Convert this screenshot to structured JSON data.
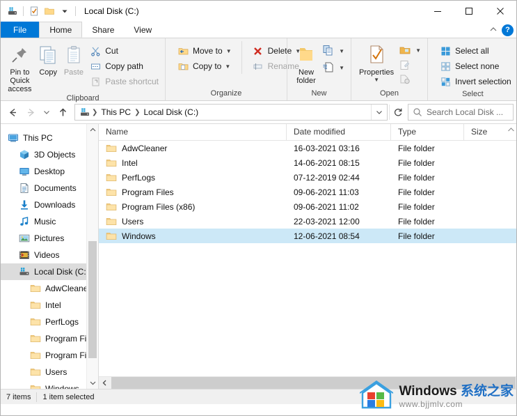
{
  "window": {
    "title": "Local Disk (C:)",
    "quick_access": [
      {
        "name": "properties-qat-icon",
        "glyph": "drive"
      },
      {
        "name": "new-folder-qat-icon",
        "glyph": "checkdoc"
      },
      {
        "name": "folder-qat-icon",
        "glyph": "folder"
      },
      {
        "name": "customize-qat-icon",
        "glyph": "caret"
      }
    ],
    "controls": {
      "minimize": "—",
      "maximize": "☐",
      "close": "✕"
    }
  },
  "tabs": [
    {
      "label": "File",
      "state": "file"
    },
    {
      "label": "Home",
      "state": "active"
    },
    {
      "label": "Share",
      "state": "normal"
    },
    {
      "label": "View",
      "state": "normal"
    }
  ],
  "ribbon": {
    "collapse_icon": "chevron-up-icon",
    "help_label": "?",
    "groups": [
      {
        "label": "Clipboard",
        "big_buttons": [
          {
            "label": "Pin to Quick access",
            "icon": "pin-icon",
            "disabled": false
          },
          {
            "label": "Copy",
            "icon": "copy-icon",
            "disabled": false
          },
          {
            "label": "Paste",
            "icon": "paste-icon",
            "disabled": true
          }
        ],
        "small_buttons": [
          {
            "label": "Cut",
            "icon": "scissors-icon",
            "disabled": false,
            "caret": false
          },
          {
            "label": "Copy path",
            "icon": "copy-path-icon",
            "disabled": false,
            "caret": false
          },
          {
            "label": "Paste shortcut",
            "icon": "paste-shortcut-icon",
            "disabled": true,
            "caret": false
          }
        ]
      },
      {
        "label": "Organize",
        "small_buttons": [
          {
            "label": "Move to",
            "icon": "move-to-icon",
            "disabled": false,
            "caret": true
          },
          {
            "label": "Copy to",
            "icon": "copy-to-icon",
            "disabled": false,
            "caret": true
          }
        ],
        "small_buttons2": [
          {
            "label": "Delete",
            "icon": "delete-icon",
            "disabled": false,
            "caret": true
          },
          {
            "label": "Rename",
            "icon": "rename-icon",
            "disabled": true,
            "caret": false
          }
        ]
      },
      {
        "label": "New",
        "big_buttons": [
          {
            "label": "New folder",
            "icon": "new-folder-icon",
            "disabled": false
          }
        ],
        "small_buttons": [
          {
            "label": "",
            "icon": "new-item-icon",
            "disabled": false,
            "caret": true
          },
          {
            "label": "",
            "icon": "easy-access-icon",
            "disabled": false,
            "caret": true
          }
        ]
      },
      {
        "label": "Open",
        "big_buttons": [
          {
            "label": "Properties",
            "icon": "properties-icon",
            "disabled": false,
            "caret": true
          }
        ],
        "small_buttons": [
          {
            "label": "",
            "icon": "open-icon",
            "disabled": false,
            "caret": true
          },
          {
            "label": "",
            "icon": "edit-icon",
            "disabled": true,
            "caret": false
          },
          {
            "label": "",
            "icon": "history-icon",
            "disabled": true,
            "caret": false
          }
        ]
      },
      {
        "label": "Select",
        "small_buttons": [
          {
            "label": "Select all",
            "icon": "select-all-icon",
            "disabled": false,
            "caret": false
          },
          {
            "label": "Select none",
            "icon": "select-none-icon",
            "disabled": false,
            "caret": false
          },
          {
            "label": "Invert selection",
            "icon": "invert-selection-icon",
            "disabled": false,
            "caret": false
          }
        ]
      }
    ]
  },
  "addressbar": {
    "back_icon": "arrow-left-icon",
    "forward_icon": "arrow-right-icon",
    "recent_icon": "chevron-down-icon",
    "up_icon": "arrow-up-icon",
    "breadcrumb": [
      {
        "label": "This PC",
        "icon": "this-pc-icon"
      },
      {
        "label": "Local Disk (C:)",
        "icon": ""
      }
    ],
    "dropdown_icon": "chevron-down-icon",
    "refresh_icon": "refresh-icon",
    "search": {
      "icon": "search-icon",
      "placeholder": "Search Local Disk ...",
      "value": ""
    }
  },
  "navpane": {
    "items": [
      {
        "label": "This PC",
        "icon": "this-pc-icon",
        "indent": 0,
        "selected": false
      },
      {
        "label": "3D Objects",
        "icon": "3d-objects-icon",
        "indent": 1,
        "selected": false
      },
      {
        "label": "Desktop",
        "icon": "desktop-icon",
        "indent": 1,
        "selected": false
      },
      {
        "label": "Documents",
        "icon": "documents-icon",
        "indent": 1,
        "selected": false
      },
      {
        "label": "Downloads",
        "icon": "downloads-icon",
        "indent": 1,
        "selected": false
      },
      {
        "label": "Music",
        "icon": "music-icon",
        "indent": 1,
        "selected": false
      },
      {
        "label": "Pictures",
        "icon": "pictures-icon",
        "indent": 1,
        "selected": false
      },
      {
        "label": "Videos",
        "icon": "videos-icon",
        "indent": 1,
        "selected": false
      },
      {
        "label": "Local Disk (C:)",
        "icon": "drive-icon",
        "indent": 1,
        "selected": true
      },
      {
        "label": "AdwCleaner",
        "icon": "folder-icon",
        "indent": 2,
        "selected": false
      },
      {
        "label": "Intel",
        "icon": "folder-icon",
        "indent": 2,
        "selected": false
      },
      {
        "label": "PerfLogs",
        "icon": "folder-icon",
        "indent": 2,
        "selected": false
      },
      {
        "label": "Program Files",
        "icon": "folder-icon",
        "indent": 2,
        "selected": false
      },
      {
        "label": "Program Files (",
        "icon": "folder-icon",
        "indent": 2,
        "selected": false
      },
      {
        "label": "Users",
        "icon": "folder-icon",
        "indent": 2,
        "selected": false
      },
      {
        "label": "Windows",
        "icon": "folder-icon",
        "indent": 2,
        "selected": false
      }
    ],
    "scroll_up_icon": "chevron-up-icon",
    "scroll_down_icon": "chevron-down-icon"
  },
  "filelist": {
    "columns": [
      {
        "label": "Name",
        "key": "name"
      },
      {
        "label": "Date modified",
        "key": "date"
      },
      {
        "label": "Type",
        "key": "type"
      },
      {
        "label": "Size",
        "key": "size"
      }
    ],
    "rows": [
      {
        "name": "AdwCleaner",
        "date": "16-03-2021 03:16",
        "type": "File folder",
        "size": "",
        "icon": "folder-icon",
        "selected": false
      },
      {
        "name": "Intel",
        "date": "14-06-2021 08:15",
        "type": "File folder",
        "size": "",
        "icon": "folder-icon",
        "selected": false
      },
      {
        "name": "PerfLogs",
        "date": "07-12-2019 02:44",
        "type": "File folder",
        "size": "",
        "icon": "folder-icon",
        "selected": false
      },
      {
        "name": "Program Files",
        "date": "09-06-2021 11:03",
        "type": "File folder",
        "size": "",
        "icon": "folder-icon",
        "selected": false
      },
      {
        "name": "Program Files (x86)",
        "date": "09-06-2021 11:02",
        "type": "File folder",
        "size": "",
        "icon": "folder-icon",
        "selected": false
      },
      {
        "name": "Users",
        "date": "22-03-2021 12:00",
        "type": "File folder",
        "size": "",
        "icon": "folder-icon",
        "selected": false
      },
      {
        "name": "Windows",
        "date": "12-06-2021 08:54",
        "type": "File folder",
        "size": "",
        "icon": "folder-icon",
        "selected": true
      }
    ],
    "hscroll_left_icon": "chevron-left-icon"
  },
  "statusbar": {
    "item_count": "7 items",
    "selection": "1 item selected"
  },
  "watermark": {
    "brand": "Windows ",
    "brand_cn": "系统之家",
    "url": "www.bjjmlv.com"
  },
  "colors": {
    "accent": "#0078d7",
    "selection": "#cce8f7",
    "folder": "#ffd98a",
    "ribbon_bg": "#f3f3f3"
  }
}
